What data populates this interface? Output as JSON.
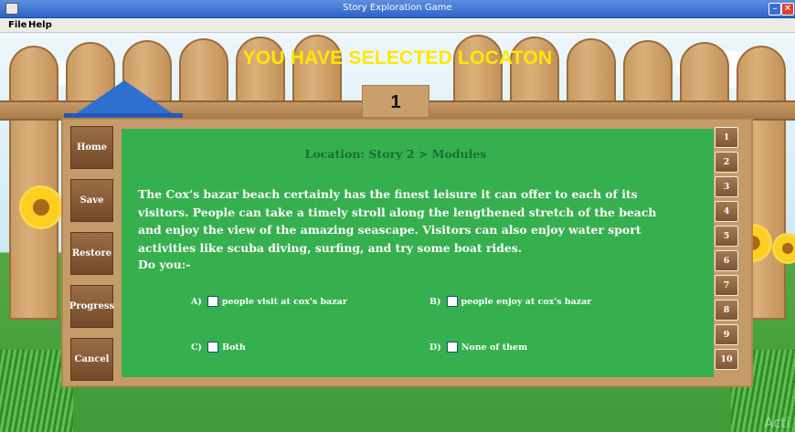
{
  "window": {
    "title": "Story Exploration Game",
    "minimize_glyph": "–",
    "close_glyph": "✕"
  },
  "menu": {
    "file": "File",
    "help": "Help"
  },
  "header": {
    "heading": "YOU HAVE SELECTED LOCATON",
    "counter": "1"
  },
  "sidebar": {
    "home": "Home",
    "save": "Save",
    "restore": "Restore",
    "progress": "Progress",
    "cancel": "Cancel"
  },
  "content": {
    "location": "Location: Story 2 > Modules",
    "question": "The Cox’s bazar beach certainly has the finest leisure it can offer to each of its visitors. People can take a timely stroll along the lengthened stretch of the beach and enjoy the view of the amazing seascape. Visitors can also enjoy water sport activities like scuba diving, surfing, and try some boat rides.",
    "prompt": "Do you:-",
    "options": [
      {
        "letter": "A)",
        "text": "people visit at cox's bazar",
        "checked": false
      },
      {
        "letter": "B)",
        "text": "people enjoy at cox's bazar",
        "checked": false
      },
      {
        "letter": "C)",
        "text": "Both",
        "checked": false
      },
      {
        "letter": "D)",
        "text": "None of them",
        "checked": false
      }
    ]
  },
  "numbers": [
    "1",
    "2",
    "3",
    "4",
    "5",
    "6",
    "7",
    "8",
    "9",
    "10"
  ],
  "watermark": "Acti",
  "colors": {
    "heading": "#ffe800",
    "panel": "#36b04e",
    "location_text": "#1c6a35"
  }
}
